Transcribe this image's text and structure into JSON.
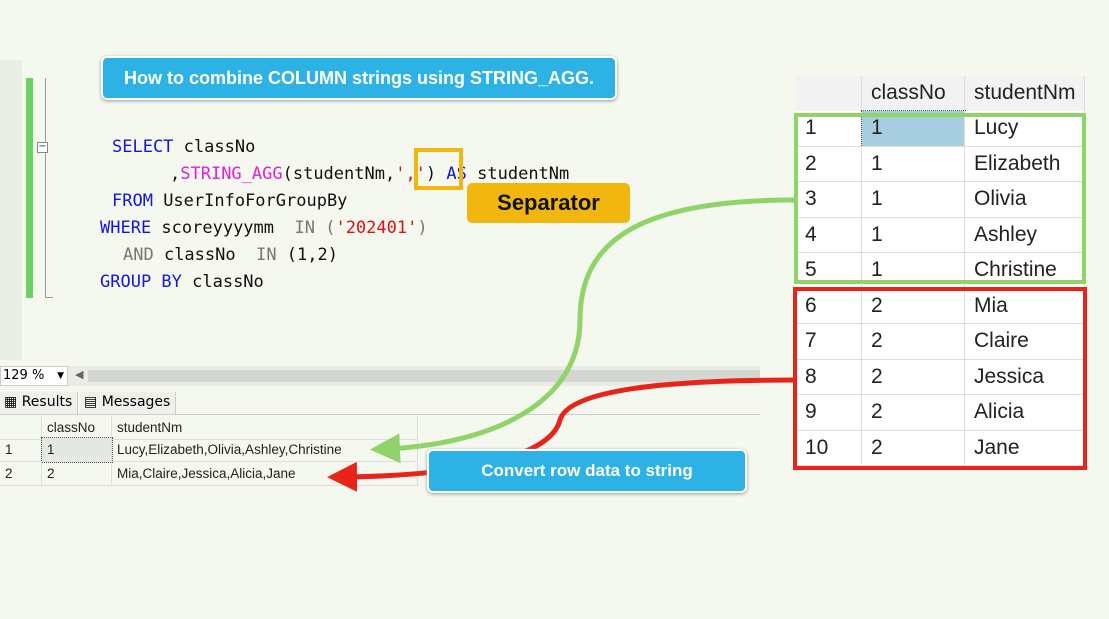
{
  "title_banner": "How to combine COLUMN strings using STRING_AGG.",
  "separator_label": "Separator",
  "convert_label": "Convert row data to string",
  "code": {
    "l1": {
      "kw": "SELECT",
      "rest": " classNo"
    },
    "l2": {
      "pre": ",",
      "fn": "STRING_AGG",
      "mid": "(studentNm,",
      "str": "','",
      "post": ")",
      "kw": "AS",
      "rest": " studentNm"
    },
    "l3": {
      "kw": "FROM",
      "rest": " UserInfoForGroupBy"
    },
    "l4": {
      "kw": "WHERE",
      "mid": " scoreyyyymm  ",
      "op": "IN",
      "open": " (",
      "str": "'202401'",
      "close": ")"
    },
    "l5": {
      "op": "AND",
      "mid": " classNo  ",
      "op2": "IN",
      "rest": " (1,2)"
    },
    "l6": {
      "kw": "GROUP BY",
      "rest": " classNo"
    }
  },
  "zoom": "129 %",
  "tabs": {
    "results": "Results",
    "messages": "Messages"
  },
  "result_grid": {
    "headers": [
      "",
      "classNo",
      "studentNm"
    ],
    "rows": [
      [
        "1",
        "1",
        "Lucy,Elizabeth,Olivia,Ashley,Christine"
      ],
      [
        "2",
        "2",
        "Mia,Claire,Jessica,Alicia,Jane"
      ]
    ]
  },
  "source_grid": {
    "headers": [
      "",
      "classNo",
      "studentNm"
    ],
    "rows": [
      [
        "1",
        "1",
        "Lucy"
      ],
      [
        "2",
        "1",
        "Elizabeth"
      ],
      [
        "3",
        "1",
        "Olivia"
      ],
      [
        "4",
        "1",
        "Ashley"
      ],
      [
        "5",
        "1",
        "Christine"
      ],
      [
        "6",
        "2",
        "Mia"
      ],
      [
        "7",
        "2",
        "Claire"
      ],
      [
        "8",
        "2",
        "Jessica"
      ],
      [
        "9",
        "2",
        "Alicia"
      ],
      [
        "10",
        "2",
        "Jane"
      ]
    ]
  },
  "colors": {
    "banner": "#2db2e5",
    "separator": "#f1b70e",
    "class1": "#8fd468",
    "class2": "#e8231a"
  }
}
